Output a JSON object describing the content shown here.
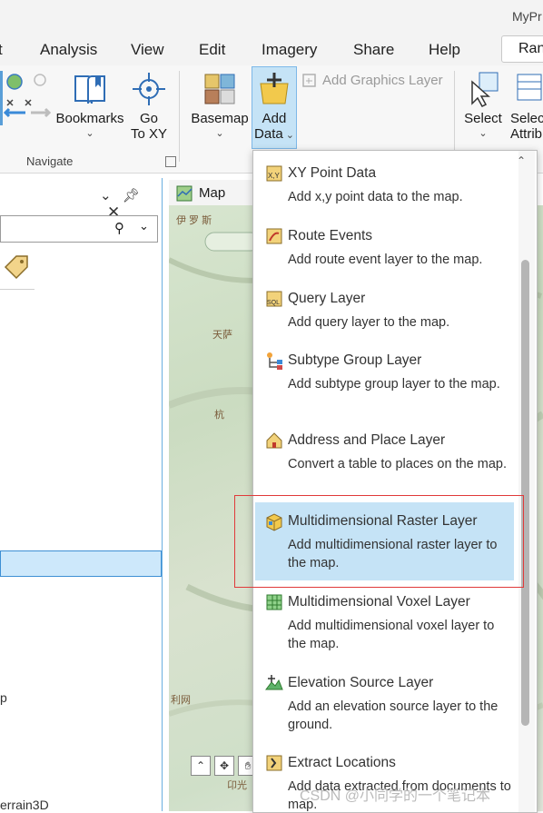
{
  "window": {
    "title": "MyPr"
  },
  "tabs": [
    "t",
    "Analysis",
    "View",
    "Edit",
    "Imagery",
    "Share",
    "Help"
  ],
  "search": {
    "text": "Ran"
  },
  "ribbon": {
    "bookmarks": "Bookmarks",
    "goto_line1": "Go",
    "goto_line2": "To XY",
    "navigate_group": "Navigate",
    "basemap": "Basemap",
    "add_line1": "Add",
    "add_line2": "Data",
    "add_graphics_layer": "Add Graphics Layer",
    "select": "Select",
    "select_attr_line1": "Selec",
    "select_attr_line2": "Attrib"
  },
  "contents_pane": {
    "selected_item": "",
    "partial_item1": "p",
    "partial_item2": "errain3D"
  },
  "map": {
    "tab_label": "Map",
    "labels": [
      "伊 罗 斯",
      "天萨",
      "杭",
      "利网",
      "卬光"
    ]
  },
  "menu": {
    "items": [
      {
        "title": "XY Point Data",
        "description": "Add x,y point data to the map.",
        "icon": "xy-icon"
      },
      {
        "title": "Route Events",
        "description": "Add route event layer to the map.",
        "icon": "route-events-icon"
      },
      {
        "title": "Query Layer",
        "description": "Add query layer to the map.",
        "icon": "sql-icon"
      },
      {
        "title": "Subtype Group Layer",
        "description": "Add subtype group layer to the map.",
        "icon": "subtype-icon"
      },
      {
        "title": "Address and Place Layer",
        "description": "Convert a table to places on the map.",
        "icon": "address-icon"
      },
      {
        "title": "Multidimensional Raster Layer",
        "description": "Add multidimensional raster layer to the map.",
        "icon": "raster-cube-icon",
        "highlighted": true
      },
      {
        "title": "Multidimensional Voxel Layer",
        "description": "Add multidimensional voxel layer to the map.",
        "icon": "voxel-icon"
      },
      {
        "title": "Elevation Source Layer",
        "description": "Add an elevation source layer to the ground.",
        "icon": "elevation-icon"
      },
      {
        "title": "Extract Locations",
        "description": "Add data extracted from documents to map.",
        "icon": "extract-icon"
      }
    ]
  },
  "watermark": "CSDN @小同学的一个笔记本",
  "colors": {
    "highlight": "#c5e3f6",
    "accent": "#3d8fd4",
    "annotation": "#e03a3a"
  }
}
